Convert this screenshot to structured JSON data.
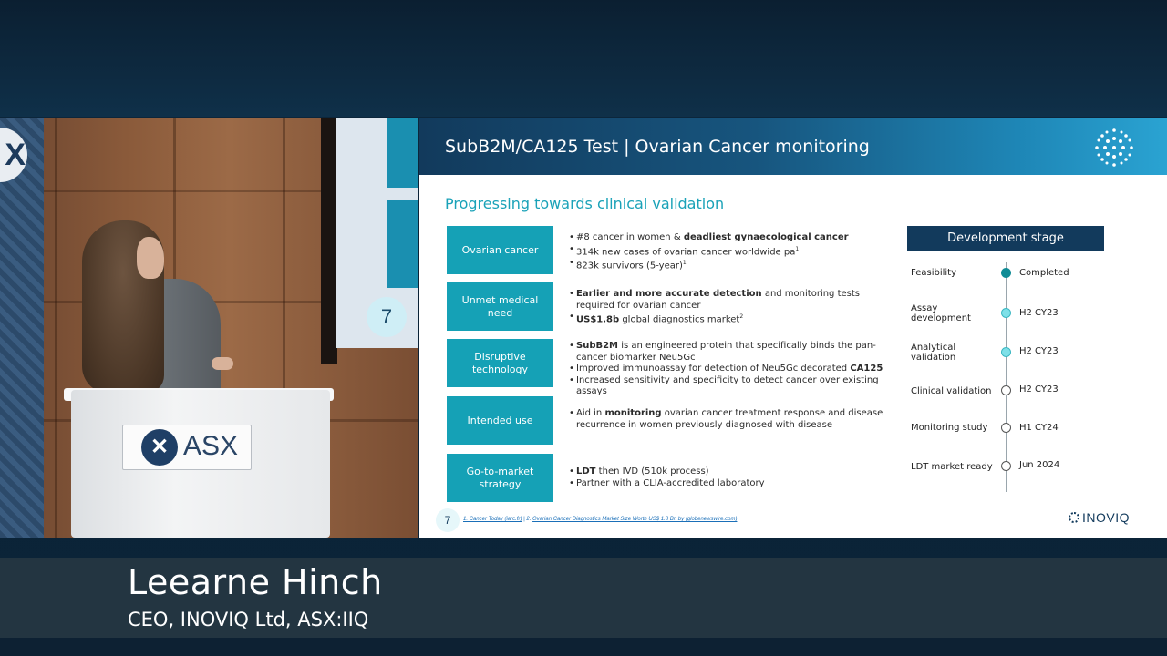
{
  "slide": {
    "title": "SubB2M/CA125 Test | Ovarian Cancer monitoring",
    "subtitle": "Progressing towards clinical validation",
    "rows": [
      {
        "label": "Ovarian cancer",
        "points": [
          {
            "pre": "#8 cancer in women & ",
            "bold": "deadliest gynaecological cancer",
            "post": "",
            "sup": ""
          },
          {
            "pre": "314k new cases of ovarian cancer worldwide pa",
            "bold": "",
            "post": "",
            "sup": "1"
          },
          {
            "pre": "823k survivors (5-year)",
            "bold": "",
            "post": "",
            "sup": "1"
          }
        ]
      },
      {
        "label": "Unmet medical need",
        "points": [
          {
            "pre": "",
            "bold": "Earlier and more accurate detection",
            "post": " and monitoring tests required for ovarian cancer",
            "sup": ""
          },
          {
            "pre": "",
            "bold": "US$1.8b",
            "post": " global diagnostics market",
            "sup": "2"
          }
        ]
      },
      {
        "label": "Disruptive technology",
        "points": [
          {
            "pre": "",
            "bold": "SubB2M",
            "post": " is an engineered protein that specifically binds the pan-cancer biomarker Neu5Gc",
            "sup": ""
          },
          {
            "pre": "Improved immunoassay for detection of Neu5Gc decorated ",
            "bold": "CA125",
            "post": "",
            "sup": ""
          },
          {
            "pre": "Increased sensitivity and specificity to detect cancer over existing assays",
            "bold": "",
            "post": "",
            "sup": ""
          }
        ]
      },
      {
        "label": "Intended use",
        "points": [
          {
            "pre": "Aid in ",
            "bold": "monitoring",
            "post": " ovarian cancer treatment response and disease recurrence in women previously diagnosed with disease",
            "sup": ""
          }
        ]
      },
      {
        "label": "Go-to-market strategy",
        "points": [
          {
            "pre": "",
            "bold": "LDT",
            "post": " then IVD (510k process)",
            "sup": ""
          },
          {
            "pre": "Partner with a CLIA-accredited laboratory",
            "bold": "",
            "post": "",
            "sup": ""
          }
        ]
      }
    ],
    "development": {
      "heading": "Development stage",
      "stages": [
        {
          "label": "Feasibility",
          "status": "Completed",
          "state": "done"
        },
        {
          "label": "Assay development",
          "status": "H2 CY23",
          "state": "active"
        },
        {
          "label": "Analytical validation",
          "status": "H2 CY23",
          "state": "active"
        },
        {
          "label": "Clinical validation",
          "status": "H2 CY23",
          "state": "pending"
        },
        {
          "label": "Monitoring study",
          "status": "H1 CY24",
          "state": "pending"
        },
        {
          "label": "LDT market ready",
          "status": "Jun 2024",
          "state": "pending"
        }
      ]
    },
    "footer": {
      "page_number": "7",
      "ref1": "1. Cancer Today (iarc.fr)",
      "ref_sep": " | 2. ",
      "ref2": "Ovarian Cancer Diagnostics Market Size Worth US$ 1.8 Bn by (globenewswire.com)",
      "logo_text": "INOVIQ"
    }
  },
  "video": {
    "podium_sign": "ASX",
    "screen_number": "7",
    "wall_letter": "X"
  },
  "lower_third": {
    "name": "Leearne Hinch",
    "role": "CEO,  INOVIQ Ltd, ASX:IIQ"
  },
  "colors": {
    "teal": "#15a1b6",
    "navy": "#123a5c",
    "subtitle_teal": "#1aa2b8"
  }
}
